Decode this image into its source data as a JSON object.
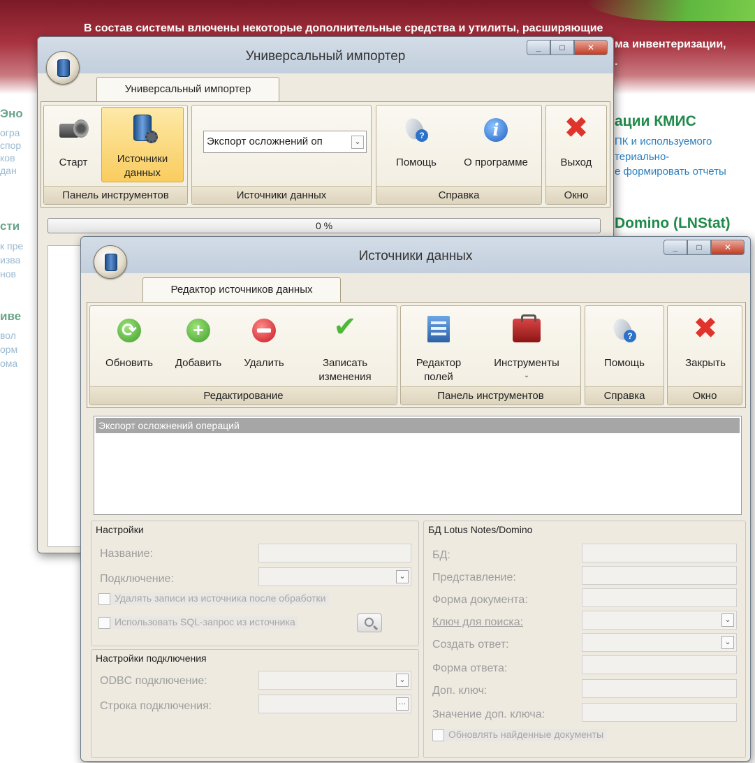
{
  "background_page": {
    "banner_line1": "В состав системы влючены некоторые дополнительные средства и утилиты, расширяющие",
    "banner_line2": "ма инвентеризации,",
    "banner_line3": ".",
    "heading_kmis": "ации КМИС",
    "kmis_line1": "ПК и используемого",
    "kmis_line2": "териально-",
    "kmis_line3": "е формировать отчеты",
    "heading_domino": "Domino (LNStat)",
    "left_fragments": [
      "Эно",
      "огра",
      "спор",
      "ков",
      "дан",
      "сти",
      "к пре",
      "изва",
      "нов",
      "иве",
      "вол",
      "орм",
      "ома"
    ]
  },
  "importer_window": {
    "title": "Универсальный импортер",
    "tab_label": "Универсальный импортер",
    "buttons": {
      "start": "Старт",
      "sources": "Источники данных",
      "help": "Помощь",
      "about": "О программе",
      "exit": "Выход"
    },
    "source_dropdown_value": "Экспорт осложнений оп",
    "groups": {
      "toolbar": "Панель инструментов",
      "sources": "Источники данных",
      "help": "Справка",
      "window": "Окно"
    },
    "progress_percent": 0,
    "progress_text": "0 %"
  },
  "sources_window": {
    "title": "Источники данных",
    "tab_label": "Редактор источников данных",
    "buttons": {
      "refresh": "Обновить",
      "add": "Добавить",
      "delete": "Удалить",
      "save": "Записать изменения",
      "field_editor": "Редактор полей",
      "tools": "Инструменты",
      "help": "Помощь",
      "close": "Закрыть"
    },
    "groups": {
      "editing": "Редактирование",
      "toolbar": "Панель инструментов",
      "help": "Справка",
      "window": "Окно"
    },
    "list_items": [
      "Экспорт осложнений операций"
    ],
    "settings": {
      "title": "Настройки",
      "name_label": "Название:",
      "connection_label": "Подключение:",
      "delete_records_label": "Удалять записи из источника после обработки",
      "use_sql_label": "Использовать SQL-запрос из источника"
    },
    "connection_settings": {
      "title": "Настройки подключения",
      "odbc_label": "ODBC подключение:",
      "conn_string_label": "Строка подключения:"
    },
    "lotus": {
      "title": "БД Lotus Notes/Domino",
      "db_label": "БД:",
      "view_label": "Представление:",
      "doc_form_label": "Форма документа:",
      "search_key_label": "Ключ для поиска:",
      "create_reply_label": "Создать ответ:",
      "reply_form_label": "Форма ответа:",
      "extra_key_label": "Доп. ключ:",
      "extra_key_value_label": "Значение доп. ключа:",
      "update_found_label": "Обновлять найденные документы"
    }
  },
  "colors": {
    "banner": "#7a1a26",
    "heading_green": "#1f8a4a",
    "link_blue": "#2a7fbf",
    "ribbon_bg": "#f3efe3",
    "active_button": "#f9cc5e",
    "selected_row": "#a6a6a6"
  },
  "icons": {
    "start": "camera-icon",
    "sources": "database-icon",
    "help": "help-icon",
    "about": "info-icon",
    "exit": "close-x-icon",
    "refresh": "refresh-icon",
    "add": "add-icon",
    "delete": "delete-icon",
    "save": "checkmark-icon",
    "field_editor": "field-editor-icon",
    "tools": "toolbox-icon"
  }
}
